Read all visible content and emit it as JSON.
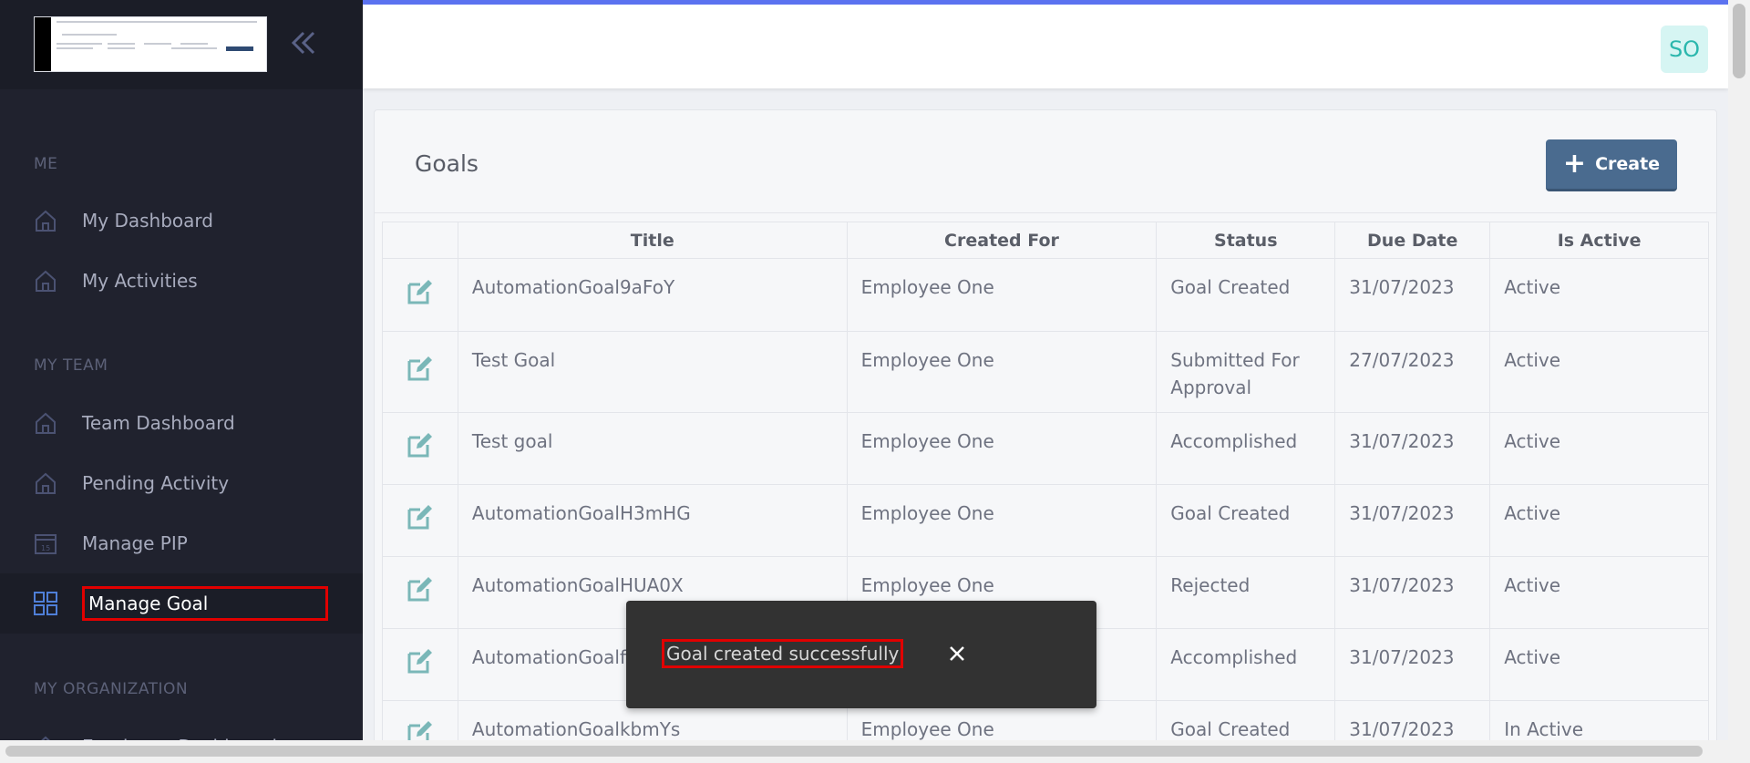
{
  "sidebar": {
    "collapse_icon": "double-chevron-left-icon",
    "sections": [
      {
        "label": "ME"
      },
      {
        "label": "MY TEAM"
      },
      {
        "label": "MY ORGANIZATION"
      }
    ],
    "items": [
      {
        "label": "My Dashboard",
        "icon": "home-icon"
      },
      {
        "label": "My Activities",
        "icon": "home-icon"
      },
      {
        "label": "Team Dashboard",
        "icon": "home-icon"
      },
      {
        "label": "Pending Activity",
        "icon": "home-icon"
      },
      {
        "label": "Manage PIP",
        "icon": "calendar-icon"
      },
      {
        "label": "Manage Goal",
        "icon": "grid-icon",
        "active": true
      },
      {
        "label": "Employee Dashboard",
        "icon": "home-icon"
      }
    ]
  },
  "header": {
    "avatar_initials": "SO",
    "accent_color": "#5b72f0"
  },
  "goals": {
    "title": "Goals",
    "create_label": "Create",
    "columns": [
      "Title",
      "Created For",
      "Status",
      "Due Date",
      "Is Active"
    ],
    "rows": [
      {
        "title": "AutomationGoal9aFoY",
        "created_for": "Employee One",
        "status": "Goal Created",
        "due_date": "31/07/2023",
        "is_active": "Active"
      },
      {
        "title": "Test Goal",
        "created_for": "Employee One",
        "status": "Submitted For Approval",
        "due_date": "27/07/2023",
        "is_active": "Active"
      },
      {
        "title": "Test goal",
        "created_for": "Employee One",
        "status": "Accomplished",
        "due_date": "31/07/2023",
        "is_active": "Active"
      },
      {
        "title": "AutomationGoalH3mHG",
        "created_for": "Employee One",
        "status": "Goal Created",
        "due_date": "31/07/2023",
        "is_active": "Active"
      },
      {
        "title": "AutomationGoalHUA0X",
        "created_for": "Employee One",
        "status": "Rejected",
        "due_date": "31/07/2023",
        "is_active": "Active"
      },
      {
        "title": "AutomationGoalf",
        "created_for": "",
        "status": "Accomplished",
        "due_date": "31/07/2023",
        "is_active": "Active"
      },
      {
        "title": "AutomationGoalkbmYs",
        "created_for": "Employee One",
        "status": "Goal Created",
        "due_date": "31/07/2023",
        "is_active": "In Active"
      }
    ]
  },
  "toast": {
    "message": "Goal created successfully",
    "close_icon": "close-icon"
  }
}
